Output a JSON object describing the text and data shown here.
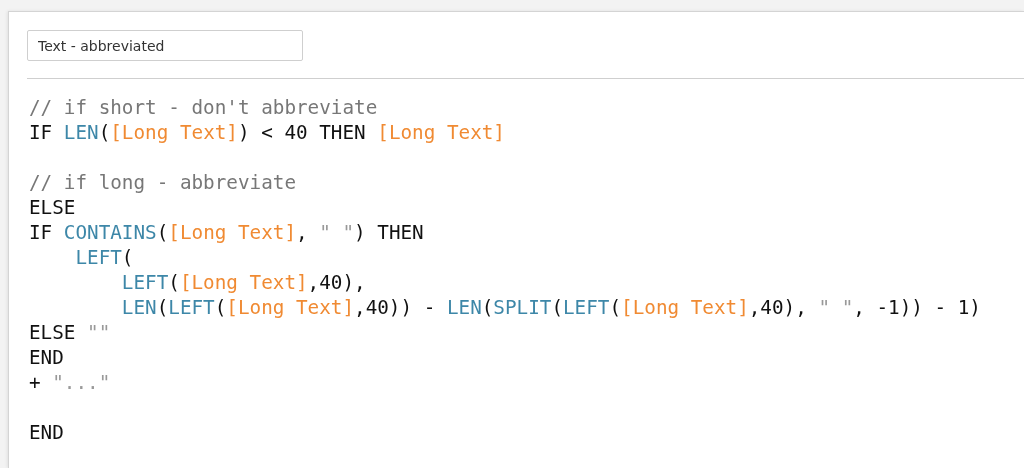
{
  "name_field": {
    "value": "Text - abbreviated"
  },
  "code_lines": [
    {
      "kind": "code",
      "tokens": [
        {
          "kind": "comment",
          "text": "// if short - don't abbreviate"
        }
      ]
    },
    {
      "kind": "code",
      "tokens": [
        {
          "kind": "plain",
          "text": "IF "
        },
        {
          "kind": "function",
          "text": "LEN"
        },
        {
          "kind": "plain",
          "text": "("
        },
        {
          "kind": "field",
          "text": "[Long Text]"
        },
        {
          "kind": "plain",
          "text": ") < 40 THEN "
        },
        {
          "kind": "field",
          "text": "[Long Text]"
        }
      ]
    },
    {
      "kind": "blank"
    },
    {
      "kind": "code",
      "tokens": [
        {
          "kind": "comment",
          "text": "// if long - abbreviate"
        }
      ]
    },
    {
      "kind": "code",
      "tokens": [
        {
          "kind": "plain",
          "text": "ELSE"
        }
      ]
    },
    {
      "kind": "code",
      "tokens": [
        {
          "kind": "plain",
          "text": "IF "
        },
        {
          "kind": "function",
          "text": "CONTAINS"
        },
        {
          "kind": "plain",
          "text": "("
        },
        {
          "kind": "field",
          "text": "[Long Text]"
        },
        {
          "kind": "plain",
          "text": ", "
        },
        {
          "kind": "string",
          "text": "\" \""
        },
        {
          "kind": "plain",
          "text": ") THEN"
        }
      ]
    },
    {
      "kind": "indented",
      "tokens": [
        {
          "kind": "function",
          "text": "LEFT"
        },
        {
          "kind": "plain",
          "text": "("
        }
      ]
    },
    {
      "kind": "double_indented",
      "tokens": [
        {
          "kind": "function",
          "text": "LEFT"
        },
        {
          "kind": "plain",
          "text": "("
        },
        {
          "kind": "field",
          "text": "[Long Text]"
        },
        {
          "kind": "plain",
          "text": ",40),"
        }
      ]
    },
    {
      "kind": "double_indented",
      "tokens": [
        {
          "kind": "function",
          "text": "LEN"
        },
        {
          "kind": "plain",
          "text": "("
        },
        {
          "kind": "function",
          "text": "LEFT"
        },
        {
          "kind": "plain",
          "text": "("
        },
        {
          "kind": "field",
          "text": "[Long Text]"
        },
        {
          "kind": "plain",
          "text": ",40)) - "
        },
        {
          "kind": "function",
          "text": "LEN"
        },
        {
          "kind": "plain",
          "text": "("
        },
        {
          "kind": "function",
          "text": "SPLIT"
        },
        {
          "kind": "plain",
          "text": "("
        },
        {
          "kind": "function",
          "text": "LEFT"
        },
        {
          "kind": "plain",
          "text": "("
        },
        {
          "kind": "field",
          "text": "[Long Text]"
        },
        {
          "kind": "plain",
          "text": ",40), "
        },
        {
          "kind": "string",
          "text": "\" \""
        },
        {
          "kind": "plain",
          "text": ", -1)) - 1)"
        }
      ]
    },
    {
      "kind": "code",
      "tokens": [
        {
          "kind": "plain",
          "text": "ELSE "
        },
        {
          "kind": "string",
          "text": "\"\""
        }
      ]
    },
    {
      "kind": "code",
      "tokens": [
        {
          "kind": "plain",
          "text": "END"
        }
      ]
    },
    {
      "kind": "code",
      "tokens": [
        {
          "kind": "plain",
          "text": "+ "
        },
        {
          "kind": "string",
          "text": "\"...\""
        }
      ]
    },
    {
      "kind": "blank"
    },
    {
      "kind": "code",
      "tokens": [
        {
          "kind": "plain",
          "text": "END"
        }
      ]
    }
  ]
}
